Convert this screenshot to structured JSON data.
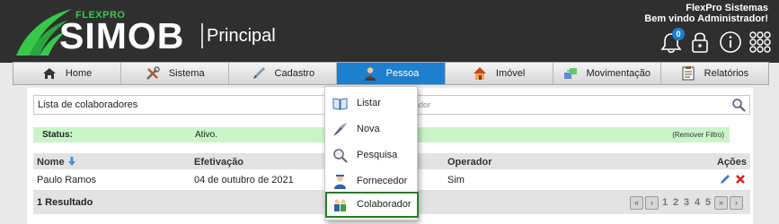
{
  "brand": {
    "tagline": "FLEXPRO",
    "name": "SIMOB",
    "page": "Principal"
  },
  "company": {
    "name": "FlexPro Sistemas",
    "welcome": "Bem vindo Administrador!"
  },
  "header_icons": {
    "notifications_count": "0",
    "icons": [
      "bell-icon",
      "lock-icon",
      "info-icon",
      "apps-grid-icon"
    ]
  },
  "nav": {
    "items": [
      {
        "label": "Home",
        "icon": "home-icon"
      },
      {
        "label": "Sistema",
        "icon": "tools-icon"
      },
      {
        "label": "Cadastro",
        "icon": "pen-icon"
      },
      {
        "label": "Pessoa",
        "icon": "person-icon"
      },
      {
        "label": "Imóvel",
        "icon": "house-icon"
      },
      {
        "label": "Movimentação",
        "icon": "transfer-icon"
      },
      {
        "label": "Relatórios",
        "icon": "report-icon"
      }
    ],
    "active": "Pessoa"
  },
  "dropdown": {
    "items": [
      {
        "label": "Listar",
        "icon": "book-icon"
      },
      {
        "label": "Nova",
        "icon": "feather-icon"
      },
      {
        "label": "Pesquisa",
        "icon": "magnifier-icon"
      },
      {
        "label": "Fornecedor",
        "icon": "supplier-icon"
      },
      {
        "label": "Colaborador",
        "icon": "team-icon"
      }
    ],
    "selected": "Colaborador"
  },
  "search": {
    "label": "Lista de colaboradores",
    "value": "rador"
  },
  "status": {
    "label": "Status:",
    "value": "Ativo.",
    "remove_filter": "(Remover Filtro)"
  },
  "table": {
    "columns": [
      "Nome",
      "Efetivação",
      "Operador",
      "Ações"
    ],
    "rows": [
      {
        "nome": "Paulo Ramos",
        "efetivacao": "04 de outubro de 2021",
        "operador": "Sim"
      }
    ],
    "footer": "1 Resultado"
  },
  "pagination": {
    "pages": [
      "1",
      "2",
      "3",
      "4",
      "5"
    ]
  },
  "colors": {
    "header_bg": "#2f2f2f",
    "brand_green": "#37c84b",
    "nav_active": "#1e80cc",
    "status_bg": "#c9f5c9",
    "selected_border": "#2d7a2d"
  }
}
